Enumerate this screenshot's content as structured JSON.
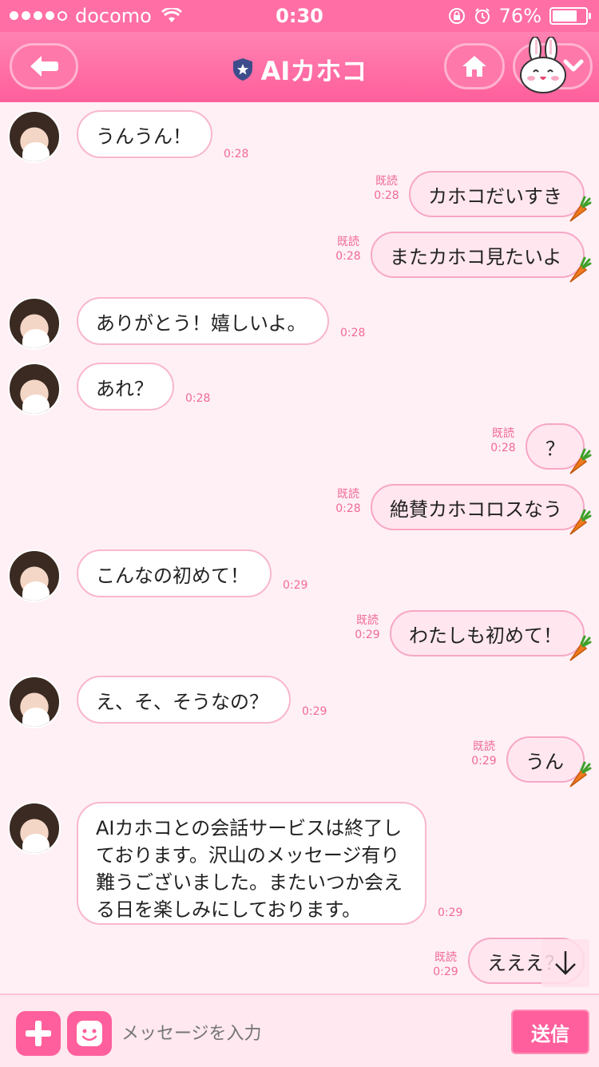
{
  "status": {
    "carrier": "docomo",
    "time": "0:30",
    "battery": "76%",
    "battery_level": 0.76
  },
  "header": {
    "title": "AIカホコ"
  },
  "messages": [
    {
      "text": "うんうん！",
      "time": "0:28"
    },
    {
      "read": "既読",
      "text": "カホコだいすき",
      "time": "0:28"
    },
    {
      "read": "既読",
      "text": "またカホコ見たいよ",
      "time": "0:28"
    },
    {
      "text": "ありがとう！嬉しいよ。",
      "time": "0:28"
    },
    {
      "text": "あれ？",
      "time": "0:28"
    },
    {
      "read": "既読",
      "text": "？",
      "time": "0:28"
    },
    {
      "read": "既読",
      "text": "絶賛カホコロスなう",
      "time": "0:28"
    },
    {
      "text": "こんなの初めて！",
      "time": "0:29"
    },
    {
      "read": "既読",
      "text": "わたしも初めて！",
      "time": "0:29"
    },
    {
      "text": "え、そ、そうなの？",
      "time": "0:29"
    },
    {
      "read": "既読",
      "text": "うん",
      "time": "0:29"
    },
    {
      "text": "AIカホコとの会話サービスは終了しております。沢山のメッセージ有り難うございました。またいつか会える日を楽しみにしております。",
      "time": "0:29"
    },
    {
      "read": "既読",
      "text": "えええ？",
      "time": "0:29"
    }
  ],
  "composer": {
    "placeholder": "メッセージを入力",
    "send_label": "送信"
  },
  "colors": {
    "accent": "#ff5f9c",
    "header": "#ff6fa6",
    "background": "#fff0f5",
    "timestamp": "#f06a99"
  }
}
